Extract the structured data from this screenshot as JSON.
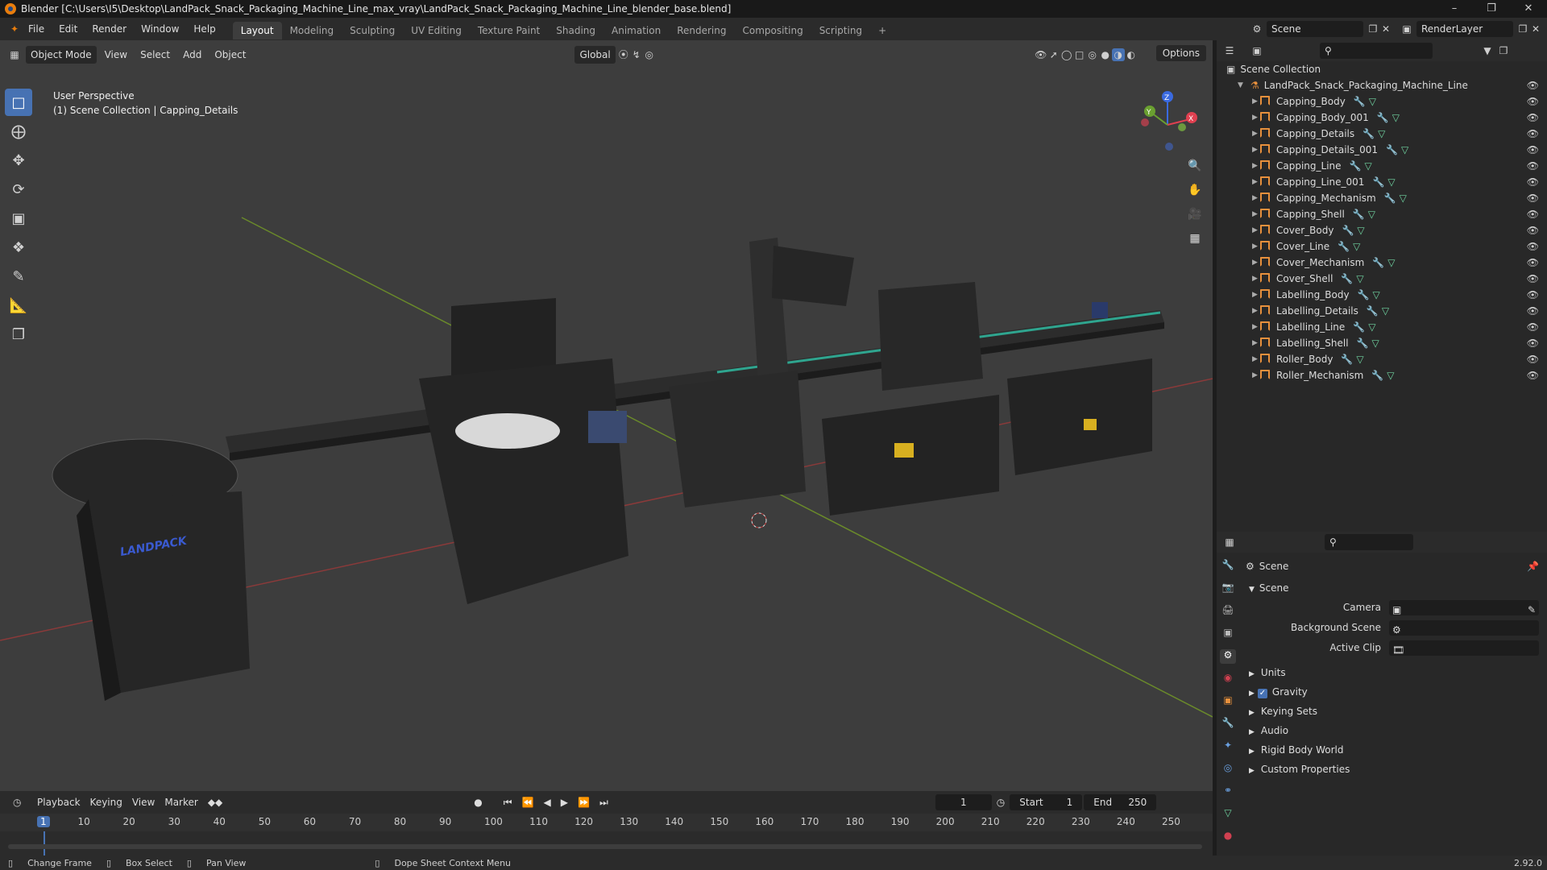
{
  "titlebar": {
    "title": "Blender [C:\\Users\\I5\\Desktop\\LandPack_Snack_Packaging_Machine_Line_max_vray\\LandPack_Snack_Packaging_Machine_Line_blender_base.blend]"
  },
  "menu": [
    "File",
    "Edit",
    "Render",
    "Window",
    "Help"
  ],
  "workspaces": [
    "Layout",
    "Modeling",
    "Sculpting",
    "UV Editing",
    "Texture Paint",
    "Shading",
    "Animation",
    "Rendering",
    "Compositing",
    "Scripting"
  ],
  "scene_field": "Scene",
  "renderlayer_field": "RenderLayer",
  "viewport": {
    "mode": "Object Mode",
    "menus": [
      "View",
      "Select",
      "Add",
      "Object"
    ],
    "orientation": "Global",
    "options": "Options",
    "perspective": "User Perspective",
    "collection_info": "(1) Scene Collection | Capping_Details"
  },
  "outliner": {
    "root": "Scene Collection",
    "collection": "LandPack_Snack_Packaging_Machine_Line",
    "objects": [
      "Capping_Body",
      "Capping_Body_001",
      "Capping_Details",
      "Capping_Details_001",
      "Capping_Line",
      "Capping_Line_001",
      "Capping_Mechanism",
      "Capping_Shell",
      "Cover_Body",
      "Cover_Line",
      "Cover_Mechanism",
      "Cover_Shell",
      "Labelling_Body",
      "Labelling_Details",
      "Labelling_Line",
      "Labelling_Shell",
      "Roller_Body",
      "Roller_Mechanism"
    ]
  },
  "properties": {
    "context": "Scene",
    "panel": "Scene",
    "camera_label": "Camera",
    "bgscene_label": "Background Scene",
    "activeclip_label": "Active Clip",
    "sections": [
      "Units",
      "Gravity",
      "Keying Sets",
      "Audio",
      "Rigid Body World",
      "Custom Properties"
    ]
  },
  "timeline": {
    "menus": [
      "Playback",
      "Keying",
      "View",
      "Marker"
    ],
    "current_frame": "1",
    "start_label": "Start",
    "start": "1",
    "end_label": "End",
    "end": "250",
    "ticks": [
      "1",
      "10",
      "20",
      "30",
      "40",
      "50",
      "60",
      "70",
      "80",
      "90",
      "100",
      "110",
      "120",
      "130",
      "140",
      "150",
      "160",
      "170",
      "180",
      "190",
      "200",
      "210",
      "220",
      "230",
      "240",
      "250"
    ]
  },
  "statusbar": {
    "items": [
      "Change Frame",
      "Box Select",
      "Pan View",
      "Dope Sheet Context Menu"
    ],
    "version": "2.92.0"
  }
}
